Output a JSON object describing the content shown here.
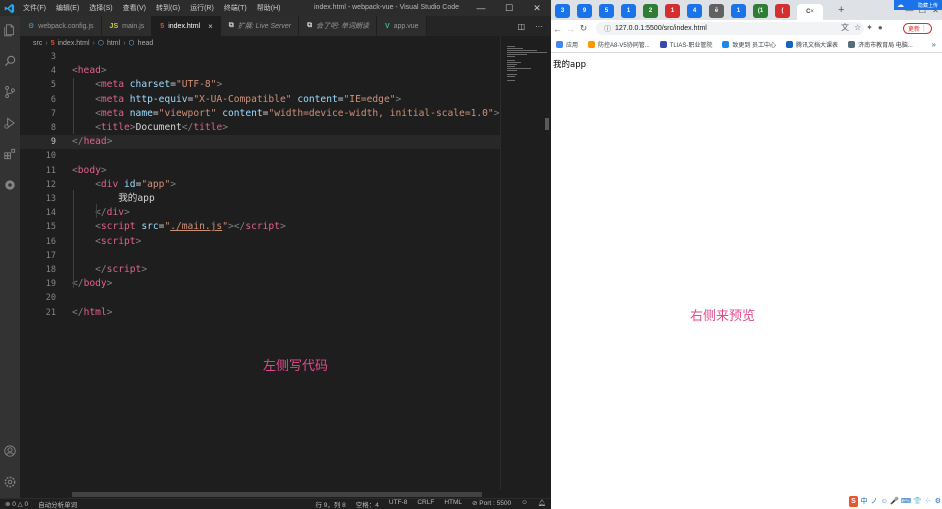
{
  "vscode": {
    "menu": [
      "文件(F)",
      "编辑(E)",
      "选择(S)",
      "查看(V)",
      "转到(G)",
      "运行(R)",
      "终端(T)",
      "帮助(H)"
    ],
    "window_title": "index.html - webpack-vue - Visual Studio Code",
    "tabs": [
      {
        "label": "webpack.config.js",
        "icon": "gear-icon",
        "icon_color": "#519aba"
      },
      {
        "label": "main.js",
        "icon": "js-icon",
        "icon_color": "#cbcb41",
        "icon_text": "JS"
      },
      {
        "label": "index.html",
        "icon": "html5-icon",
        "icon_color": "#e44d26",
        "active": true
      },
      {
        "label": "扩展: Live Server",
        "icon": "extension-icon",
        "icon_color": "#cccccc"
      },
      {
        "label": "会了吧: 单词朗读",
        "icon": "extension-icon",
        "icon_color": "#cccccc"
      },
      {
        "label": "app.vue",
        "icon": "vue-icon",
        "icon_color": "#41b883"
      }
    ],
    "breadcrumb": [
      "src",
      "index.html",
      "html",
      "head"
    ],
    "code_lines": [
      {
        "n": "3",
        "html": ""
      },
      {
        "n": "4",
        "html": "<span class='t-p'>&lt;</span><span class='t-tag'>head</span><span class='t-p'>&gt;</span>"
      },
      {
        "n": "5",
        "html": "    <span class='t-p'>&lt;</span><span class='t-tag'>meta</span> <span class='t-attr'>charset</span><span class='t-eq'>=</span><span class='t-str'>\"UTF-8\"</span><span class='t-p'>&gt;</span>"
      },
      {
        "n": "6",
        "html": "    <span class='t-p'>&lt;</span><span class='t-tag'>meta</span> <span class='t-attr'>http-equiv</span><span class='t-eq'>=</span><span class='t-str'>\"X-UA-Compatible\"</span> <span class='t-attr'>content</span><span class='t-eq'>=</span><span class='t-str'>\"IE=edge\"</span><span class='t-p'>&gt;</span>"
      },
      {
        "n": "7",
        "html": "    <span class='t-p'>&lt;</span><span class='t-tag'>meta</span> <span class='t-attr'>name</span><span class='t-eq'>=</span><span class='t-str'>\"viewport\"</span> <span class='t-attr'>content</span><span class='t-eq'>=</span><span class='t-str'>\"width=device-width, initial-scale=1.0\"</span><span class='t-p'>&gt;</span>"
      },
      {
        "n": "8",
        "html": "    <span class='t-p'>&lt;</span><span class='t-tag'>title</span><span class='t-p'>&gt;</span><span class='t-txt'>Document</span><span class='t-p'>&lt;/</span><span class='t-tag'>title</span><span class='t-p'>&gt;</span>"
      },
      {
        "n": "9",
        "html": "<span class='t-p'>&lt;/</span><span class='t-tag'>head</span><span class='t-p'>&gt;</span>",
        "current": true
      },
      {
        "n": "10",
        "html": ""
      },
      {
        "n": "11",
        "html": "<span class='t-p'>&lt;</span><span class='t-tag'>body</span><span class='t-p'>&gt;</span>"
      },
      {
        "n": "12",
        "html": "    <span class='t-p'>&lt;</span><span class='t-tag'>div</span> <span class='t-attr'>id</span><span class='t-eq'>=</span><span class='t-str'>\"app\"</span><span class='t-p'>&gt;</span>"
      },
      {
        "n": "13",
        "html": "        <span class='t-txt'>我的app</span>"
      },
      {
        "n": "14",
        "html": "    <span class='t-p'>&lt;/</span><span class='t-tag'>div</span><span class='t-p'>&gt;</span>"
      },
      {
        "n": "15",
        "html": "    <span class='t-p'>&lt;</span><span class='t-tag'>script</span> <span class='t-attr'>src</span><span class='t-eq'>=</span><span class='t-str'>\"</span><span class='t-link'>./main.js</span><span class='t-str'>\"</span><span class='t-p'>&gt;&lt;/</span><span class='t-tag'>script</span><span class='t-p'>&gt;</span>"
      },
      {
        "n": "16",
        "html": "    <span class='t-p'>&lt;</span><span class='t-tag'>script</span><span class='t-p'>&gt;</span>"
      },
      {
        "n": "17",
        "html": ""
      },
      {
        "n": "18",
        "html": "    <span class='t-p'>&lt;/</span><span class='t-tag'>script</span><span class='t-p'>&gt;</span>"
      },
      {
        "n": "19",
        "html": "<span class='t-p'>&lt;/</span><span class='t-tag'>body</span><span class='t-p'>&gt;</span>"
      },
      {
        "n": "20",
        "html": ""
      },
      {
        "n": "21",
        "html": "<span class='t-p'>&lt;/</span><span class='t-tag'>html</span><span class='t-p'>&gt;</span>"
      }
    ],
    "annotation": "左侧写代码",
    "status": {
      "problems": "⊗ 0 △ 0",
      "analysis": "自动分析单词",
      "position": "行 9，列 8",
      "spaces": "空格：4",
      "encoding": "UTF-8",
      "eol": "CRLF",
      "language": "HTML",
      "port": "⊘ Port : 5500"
    }
  },
  "chrome": {
    "tabs": [
      {
        "icon": "tab-favicon",
        "color": "#1a73e8",
        "text": "3"
      },
      {
        "icon": "tab-favicon",
        "color": "#1a73e8",
        "text": "9"
      },
      {
        "icon": "tab-favicon",
        "color": "#1a73e8",
        "text": "5"
      },
      {
        "icon": "tab-favicon",
        "color": "#1a73e8",
        "text": "1"
      },
      {
        "icon": "tab-favicon",
        "color": "#2e7d32",
        "text": "2"
      },
      {
        "icon": "tab-favicon",
        "color": "#d32f2f",
        "text": "1"
      },
      {
        "icon": "tab-favicon",
        "color": "#1a73e8",
        "text": "4"
      },
      {
        "icon": "tab-favicon",
        "color": "#616161",
        "text": "ē"
      },
      {
        "icon": "tab-favicon",
        "color": "#1a73e8",
        "text": "1"
      },
      {
        "icon": "tab-favicon",
        "color": "#2e7d32",
        "text": "(1"
      },
      {
        "icon": "tab-favicon",
        "color": "#d32f2f",
        "text": "("
      },
      {
        "icon": "tab-favicon",
        "color": "#555",
        "text": "C",
        "active": true
      }
    ],
    "ext_label": "隐藏上传",
    "url": "127.0.0.1:5500/src/index.html",
    "update_label": "更新",
    "bookmarks": [
      {
        "label": "应用",
        "color": "#4285f4"
      },
      {
        "label": "防控A8-V5协同管...",
        "color": "#ff9800"
      },
      {
        "label": "TLIAS-职业管院",
        "color": "#3949ab"
      },
      {
        "label": "致更到 员工中心",
        "color": "#1e88e5"
      },
      {
        "label": "腾讯文档大课表",
        "color": "#1565c0"
      },
      {
        "label": "济南市教育局 电脑...",
        "color": "#546e7a"
      }
    ],
    "page_text": "我的app",
    "annotation": "右侧来预览",
    "ime": [
      "中",
      "ノ",
      "☺",
      "🎤",
      "⌨",
      "👕",
      "⁘",
      "⚙"
    ]
  }
}
